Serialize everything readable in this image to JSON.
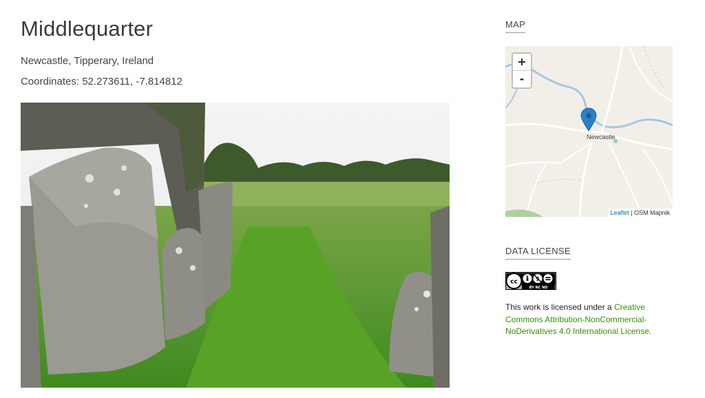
{
  "page": {
    "title": "Middlequarter",
    "location": "Newcastle, Tipperary, Ireland",
    "coordinates_label": "Coordinates:",
    "coordinates_value": "52.273611, -7.814812"
  },
  "map": {
    "heading": "MAP",
    "zoom_in": "+",
    "zoom_out": "-",
    "place_label": "Newcastle",
    "attribution_link": "Leaflet",
    "attribution_sep": " | ",
    "attribution_source": "OSM Mapnik"
  },
  "license": {
    "heading": "DATA LICENSE",
    "badge_text": "BY NC ND",
    "prefix": "This work is licensed under a ",
    "link": "Creative Commons Attribution-NonCommercial-NoDerivatives 4.0 International License",
    "suffix": "."
  },
  "colors": {
    "link_green": "#3b8d0a",
    "leaflet_blue": "#0078a8",
    "marker_blue": "#2a81cb",
    "river_blue": "#a5c8de"
  }
}
